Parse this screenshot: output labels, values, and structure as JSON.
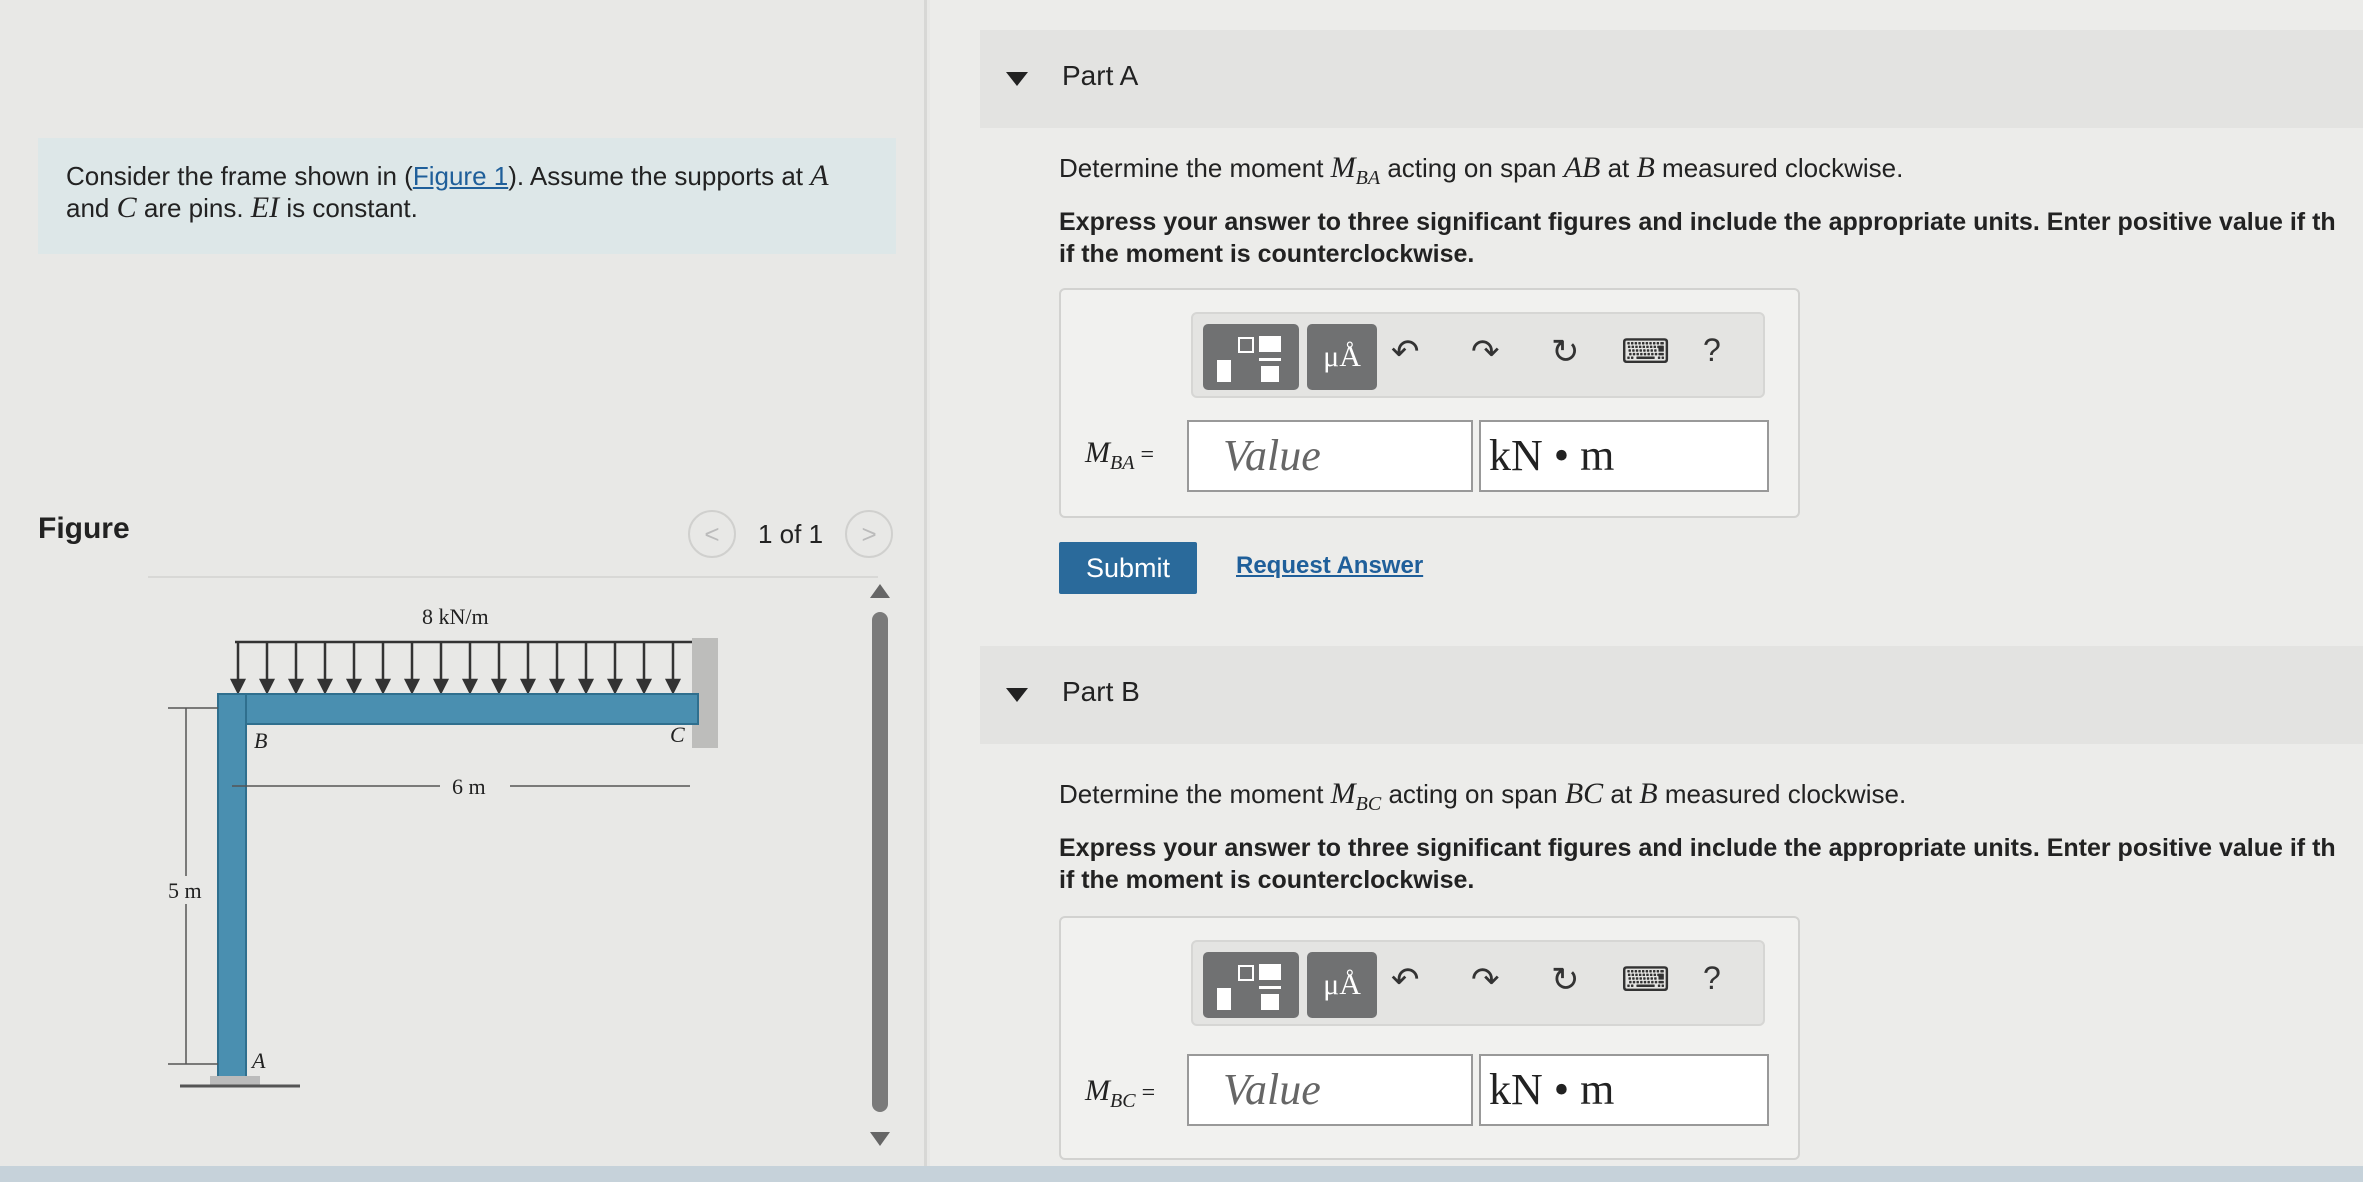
{
  "problem": {
    "text_before_link": "Consider the frame shown in (",
    "link": "Figure 1",
    "text_after_link": "). Assume the supports at ",
    "var_A": "A",
    "text_line2_a": "and ",
    "var_C": "C",
    "text_line2_b": " are pins. ",
    "var_EI": "EI",
    "text_line2_c": " is constant."
  },
  "figure": {
    "label": "Figure",
    "pager_text": "1 of 1",
    "prev_glyph": "<",
    "next_glyph": ">",
    "load_label": "8 kN/m",
    "span_label": "6 m",
    "height_label": "5 m",
    "node_A": "A",
    "node_B": "B",
    "node_C": "C"
  },
  "partA": {
    "title": "Part A",
    "q_pre": "Determine the moment ",
    "q_M": "M",
    "q_sub": "BA",
    "q_mid": " acting on span ",
    "q_span": "AB",
    "q_at": " at ",
    "q_node": "B",
    "q_post": " measured clockwise.",
    "instructions_line1": "Express your answer to three significant figures and include the appropriate units. Enter positive value if th",
    "instructions_line2": "if the moment is counterclockwise.",
    "answer_label_M": "M",
    "answer_label_sub": "BA",
    "answer_eq": " =",
    "value_placeholder": "Value",
    "units_value": "kN • m",
    "submit": "Submit",
    "request_answer": "Request Answer"
  },
  "partB": {
    "title": "Part B",
    "q_pre": "Determine the moment ",
    "q_M": "M",
    "q_sub": "BC",
    "q_mid": " acting on span ",
    "q_span": "BC",
    "q_at": " at ",
    "q_node": "B",
    "q_post": " measured clockwise.",
    "instructions_line1": "Express your answer to three significant figures and include the appropriate units. Enter positive value if th",
    "instructions_line2": "if the moment is counterclockwise.",
    "answer_label_M": "M",
    "answer_label_sub": "BC",
    "answer_eq": " =",
    "value_placeholder": "Value",
    "units_value": "kN • m"
  },
  "toolbar": {
    "units_btn": "μÅ",
    "undo": "↶",
    "redo": "↷",
    "reset": "↻",
    "keyboard": "⌨",
    "help": "?"
  },
  "icons": [
    "templates-icon",
    "units-icon",
    "undo-icon",
    "redo-icon",
    "reset-icon",
    "keyboard-icon",
    "help-icon",
    "collapse-triangle-icon"
  ]
}
